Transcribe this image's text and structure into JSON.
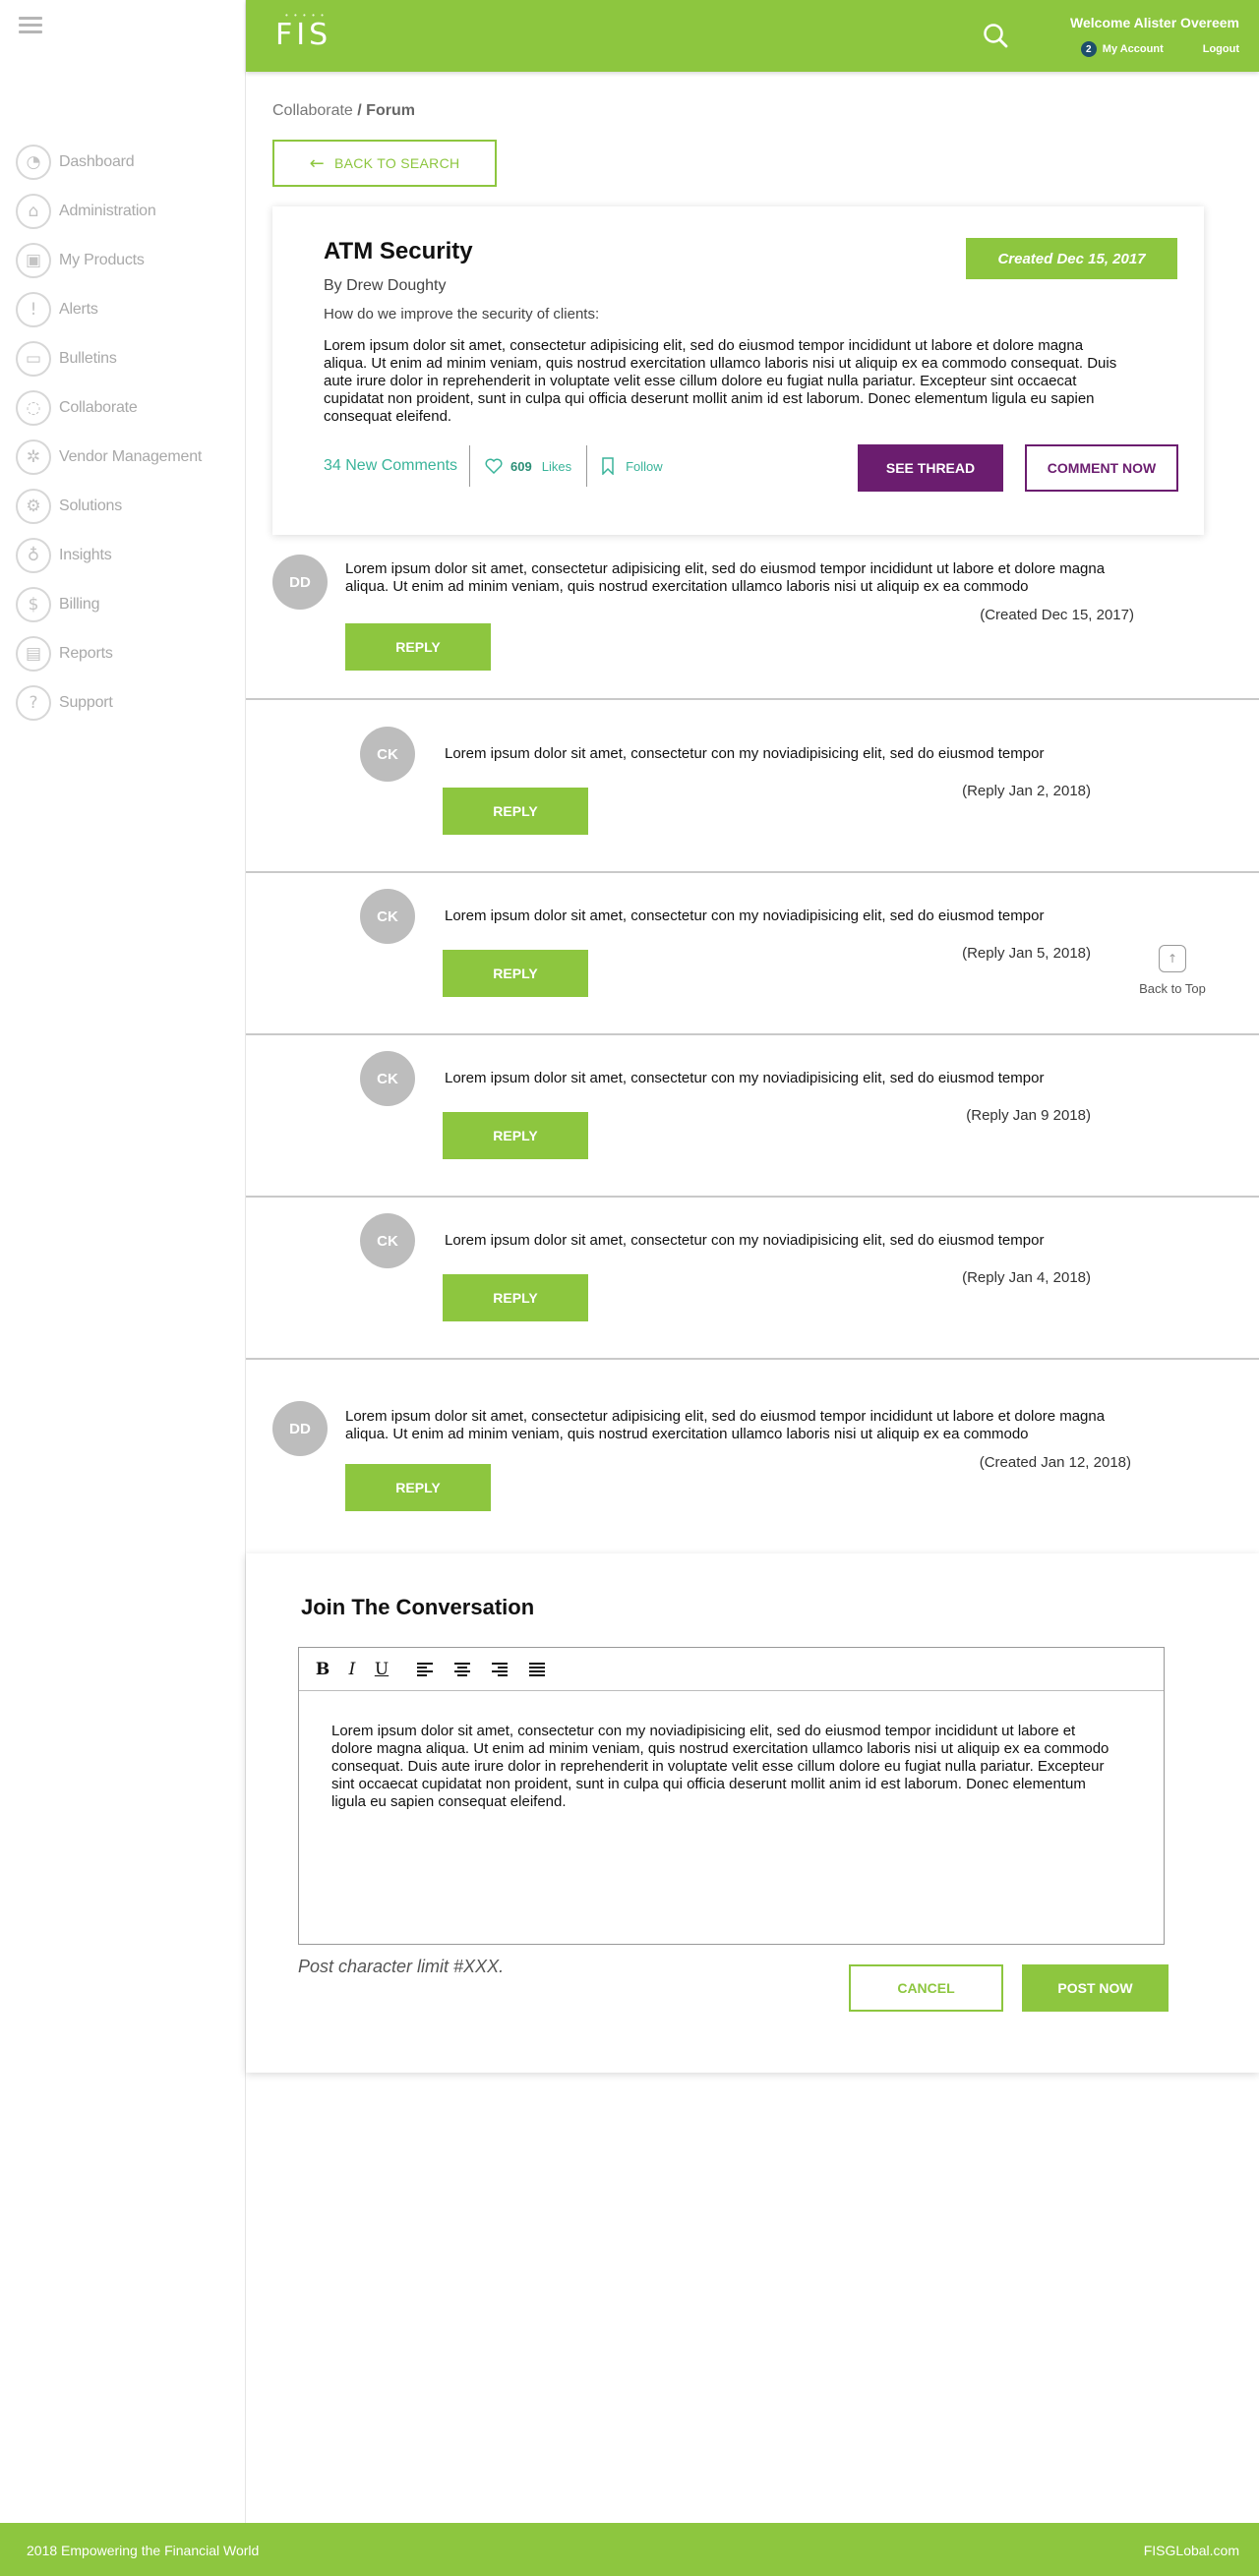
{
  "header": {
    "logo_dots": "• • • • •",
    "logo": "FIS",
    "welcome": "Welcome Alister Overeem",
    "account_badge": "2",
    "my_account": "My Account",
    "logout": "Logout",
    "brand_color": "#8dc63f"
  },
  "sidebar": {
    "items": [
      {
        "label": "Dashboard",
        "icon": "dashboard-icon",
        "glyph": "◔"
      },
      {
        "label": "Administration",
        "icon": "bank-icon",
        "glyph": "⌂"
      },
      {
        "label": "My Products",
        "icon": "box-icon",
        "glyph": "▣"
      },
      {
        "label": "Alerts",
        "icon": "alert-icon",
        "glyph": "!"
      },
      {
        "label": "Bulletins",
        "icon": "folder-icon",
        "glyph": "▭"
      },
      {
        "label": "Collaborate",
        "icon": "chat-icon",
        "glyph": "◌"
      },
      {
        "label": "Vendor Management",
        "icon": "vendor-icon",
        "glyph": "✲"
      },
      {
        "label": "Solutions",
        "icon": "gears-icon",
        "glyph": "⚙"
      },
      {
        "label": "Insights",
        "icon": "lightbulb-icon",
        "glyph": "♁"
      },
      {
        "label": "Billing",
        "icon": "billing-icon",
        "glyph": "$"
      },
      {
        "label": "Reports",
        "icon": "reports-icon",
        "glyph": "▤"
      },
      {
        "label": "Support",
        "icon": "question-icon",
        "glyph": "?"
      }
    ]
  },
  "breadcrumb": {
    "parent": "Collaborate",
    "separator": " / ",
    "current": "Forum"
  },
  "back_to_search": "BACK TO SEARCH",
  "thread": {
    "title": "ATM Security",
    "created": "Created Dec 15, 2017",
    "author": "By Drew Doughty",
    "question": "How do we improve the security of clients:",
    "body": "Lorem ipsum dolor sit amet, consectetur adipisicing elit, sed do eiusmod tempor incididunt ut labore et dolore magna aliqua. Ut enim ad minim veniam, quis nostrud exercitation ullamco laboris nisi ut aliquip ex ea commodo consequat. Duis aute irure dolor in reprehenderit in voluptate velit esse cillum dolore eu fugiat nulla pariatur. Excepteur sint occaecat cupidatat non proident, sunt in culpa qui officia deserunt mollit anim id est laborum. Donec elementum ligula eu sapien consequat eleifend.",
    "comments": "34 New Comments",
    "likes_count": "609",
    "likes_label": "Likes",
    "follow": "Follow",
    "see_thread": "SEE THREAD",
    "comment_now": "COMMENT NOW",
    "accent_color": "#6b1d6f"
  },
  "comments": [
    {
      "initials": "DD",
      "text": "Lorem ipsum dolor sit amet, consectetur adipisicing elit, sed do eiusmod tempor incididunt ut labore et dolore magna aliqua. Ut enim ad minim veniam, quis nostrud exercitation ullamco laboris nisi ut aliquip ex ea commodo",
      "date": "(Created Dec 15, 2017)",
      "reply": "REPLY"
    },
    {
      "initials": "CK",
      "text": "Lorem ipsum dolor sit amet, consectetur  con my noviadipisicing elit, sed do eiusmod tempor",
      "date": "(Reply Jan 2, 2018)",
      "reply": "REPLY"
    },
    {
      "initials": "CK",
      "text": "Lorem ipsum dolor sit amet, consectetur  con my noviadipisicing elit, sed do eiusmod tempor",
      "date": "(Reply Jan 5, 2018)",
      "reply": "REPLY"
    },
    {
      "initials": "CK",
      "text": "Lorem ipsum dolor sit amet, consectetur  con my noviadipisicing elit, sed do eiusmod tempor",
      "date": "(Reply Jan 9 2018)",
      "reply": "REPLY"
    },
    {
      "initials": "CK",
      "text": "Lorem ipsum dolor sit amet, consectetur  con my noviadipisicing elit, sed do eiusmod tempor",
      "date": "(Reply Jan 4, 2018)",
      "reply": "REPLY"
    },
    {
      "initials": "DD",
      "text": "Lorem ipsum dolor sit amet, consectetur adipisicing elit, sed do eiusmod tempor incididunt ut labore et dolore magna aliqua. Ut enim ad minim veniam, quis nostrud exercitation ullamco laboris nisi ut aliquip ex ea commodo",
      "date": "(Created Jan 12, 2018)",
      "reply": "REPLY"
    }
  ],
  "back_to_top": "Back to Top",
  "join": {
    "title": "Join The Conversation",
    "toolbar": {
      "bold": "B",
      "italic": "I",
      "underline": "U"
    },
    "editor_text": "Lorem ipsum dolor sit amet, consectetur  con my noviadipisicing elit, sed do eiusmod tempor incididunt ut labore et dolore magna aliqua. Ut enim ad minim veniam, quis nostrud exercitation ullamco laboris nisi ut aliquip ex ea commodo consequat. Duis aute irure dolor in reprehenderit in voluptate velit esse cillum dolore eu fugiat nulla pariatur. Excepteur sint occaecat cupidatat non proident, sunt in culpa qui officia deserunt mollit anim id est laborum. Donec elementum ligula eu sapien consequat eleifend.",
    "char_limit": "Post character limit #XXX.",
    "cancel": "CANCEL",
    "post": "POST NOW"
  },
  "footer": {
    "left": "2018 Empowering the Financial World",
    "right": "FISGLobal.com"
  }
}
